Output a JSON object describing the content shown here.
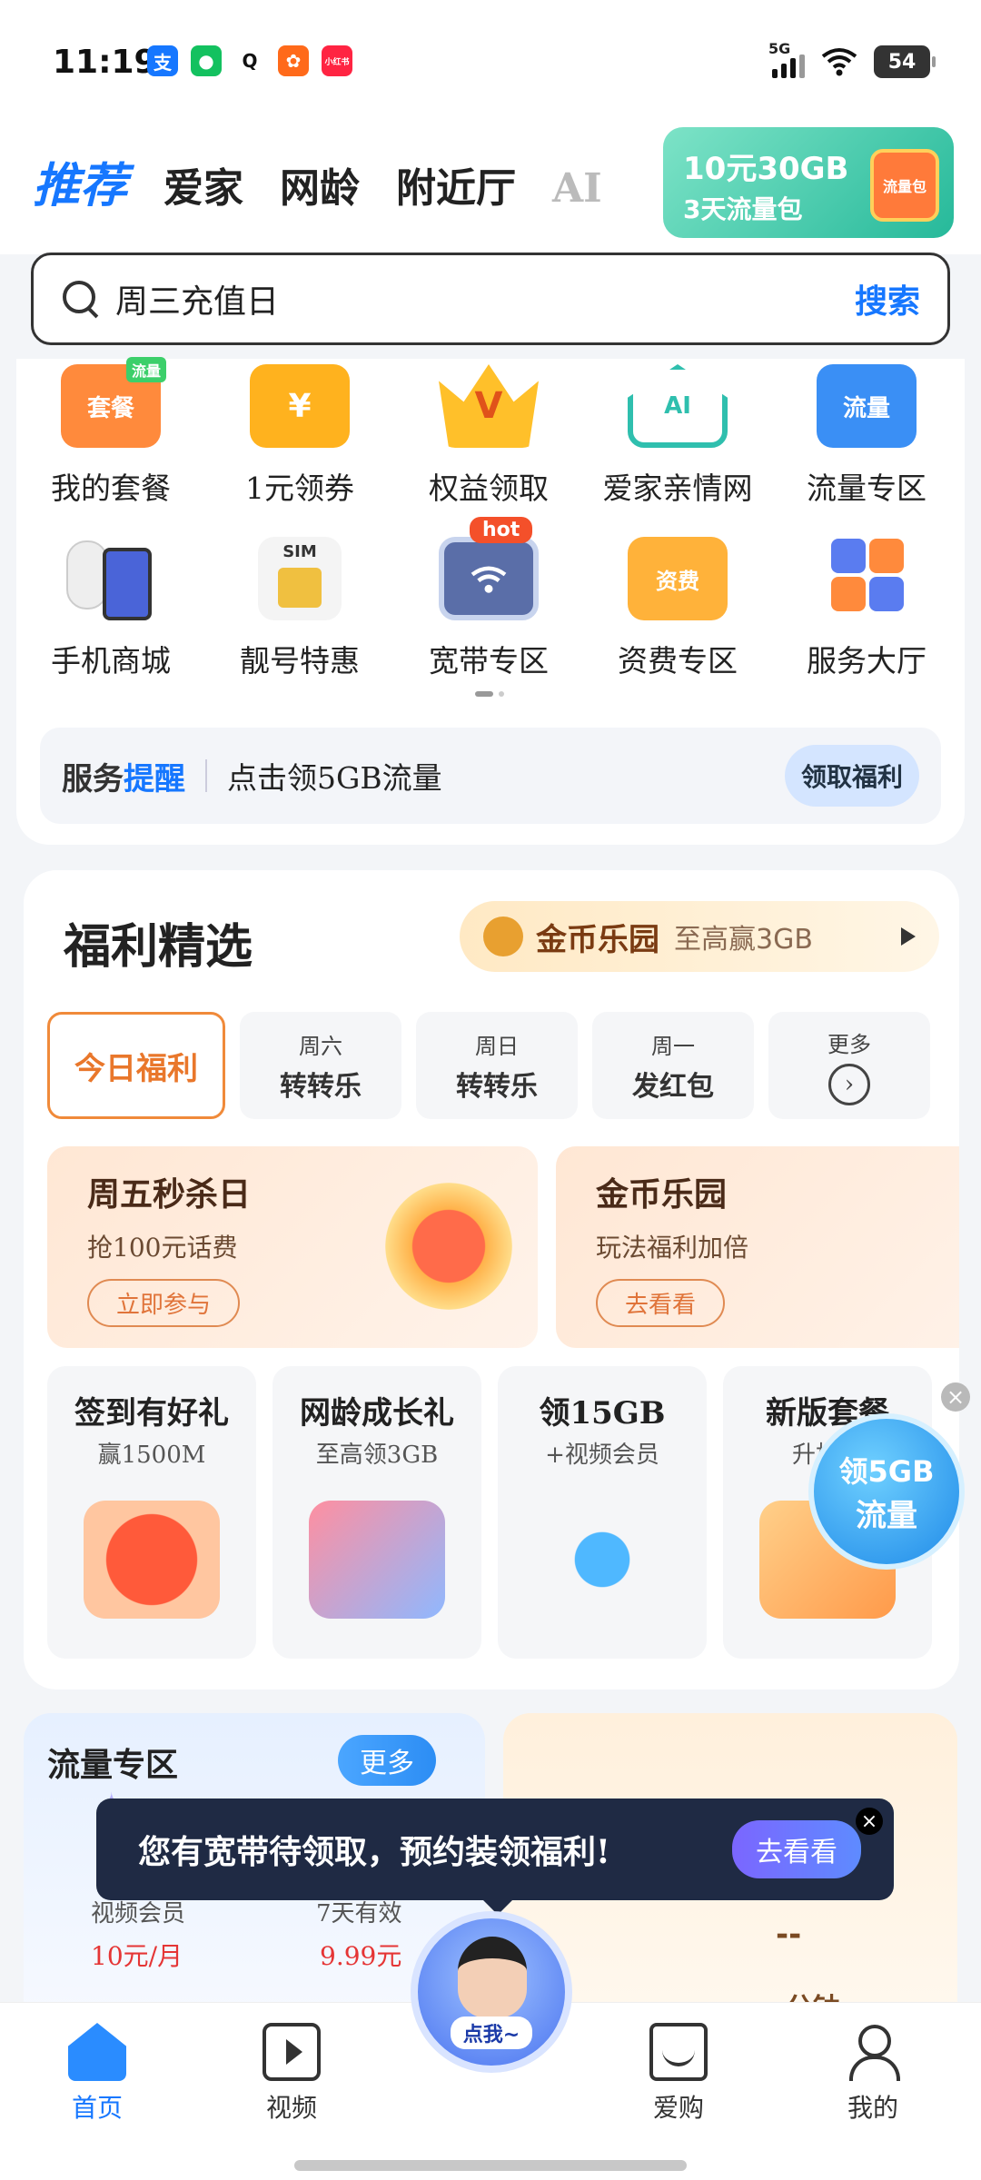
{
  "status_bar": {
    "time": "11:19",
    "network": "5G",
    "battery": "54",
    "app_icons": [
      {
        "name": "alipay-icon",
        "glyph": "支",
        "color": "#1677ff"
      },
      {
        "name": "wechat-icon",
        "glyph": "●",
        "color": "#13c15f"
      },
      {
        "name": "qq-icon",
        "glyph": "Q",
        "color": "#111111"
      },
      {
        "name": "taobao-icon",
        "glyph": "✿",
        "color": "#ff6a1a"
      },
      {
        "name": "xiaohongshu-icon",
        "glyph": "小红书",
        "color": "#ff2442"
      }
    ]
  },
  "top_nav": {
    "tabs": [
      "推荐",
      "爱家",
      "网龄",
      "附近厅",
      "AI"
    ],
    "promo_line1": "10元30GB",
    "promo_line2": "3天流量包",
    "promo_tag": "流量包"
  },
  "search": {
    "placeholder": "周三充值日",
    "button": "搜索"
  },
  "services": {
    "row1": [
      {
        "label": "我的套餐",
        "icon": "package-icon",
        "glyph": "套餐",
        "badge_text": "流量",
        "color": "#ff8a3c"
      },
      {
        "label": "1元领券",
        "icon": "coupon-icon",
        "glyph": "¥",
        "color": "#ffb21e"
      },
      {
        "label": "权益领取",
        "icon": "crown-icon",
        "glyph": "V",
        "color": "#ffc02a"
      },
      {
        "label": "爱家亲情网",
        "icon": "ai-home-icon",
        "glyph": "AI",
        "color": "#2fbfae"
      },
      {
        "label": "流量专区",
        "icon": "data-shop-icon",
        "glyph": "流量",
        "color": "#3a8ff5"
      }
    ],
    "row2": [
      {
        "label": "手机商城",
        "icon": "phone-camera-icon",
        "glyph": "",
        "color": "#4a64d8"
      },
      {
        "label": "靓号特惠",
        "icon": "sim-card-icon",
        "glyph": "SIM",
        "color": "#f0c040"
      },
      {
        "label": "宽带专区",
        "icon": "wifi-tv-icon",
        "glyph": "wifi",
        "color": "#5a6ea8",
        "hot": "hot"
      },
      {
        "label": "资费专区",
        "icon": "tariff-icon",
        "glyph": "资费",
        "color": "#ffb23a"
      },
      {
        "label": "服务大厅",
        "icon": "service-grid-icon",
        "glyph": "",
        "color": "#5a7cf0"
      }
    ]
  },
  "reminder": {
    "title_a": "服务",
    "title_b": "提醒",
    "text": "点击领5GB流量",
    "button": "领取福利"
  },
  "welfare": {
    "title": "福利精选",
    "coin_name": "金币乐园",
    "coin_sub": "至高赢3GB",
    "day_tabs": [
      {
        "day": "",
        "label": "今日福利",
        "active": true
      },
      {
        "day": "周六",
        "label": "转转乐"
      },
      {
        "day": "周日",
        "label": "转转乐"
      },
      {
        "day": "周一",
        "label": "发红包"
      },
      {
        "day": "更多",
        "label": ""
      }
    ],
    "promo_cards": [
      {
        "title": "周五秒杀日",
        "sub": "抢100元话费",
        "button": "立即参与"
      },
      {
        "title": "金币乐园",
        "sub": "玩法福利加倍",
        "button": "去看看"
      }
    ],
    "gift_cards": [
      {
        "title": "签到有好礼",
        "sub": "赢1500M",
        "color": "#ff6a4a"
      },
      {
        "title": "网龄成长礼",
        "sub": "至高领3GB",
        "color": "#ff8fa0"
      },
      {
        "title": "领15GB",
        "sub": "+视频会员",
        "color": "#4fb8ff"
      },
      {
        "title": "新版套餐",
        "sub": "升档享",
        "color": "#ffb24a"
      }
    ],
    "float_badge_1": "领5GB",
    "float_badge_2": "流量"
  },
  "flow": {
    "title": "流量专区",
    "more": "更多",
    "item1_sub": "视频会员",
    "item1_price": "10元/月",
    "item2_sub": "7天有效",
    "item2_price": "9.99元",
    "dash": "--",
    "minutes": "--分钟"
  },
  "tip": {
    "text": "您有宽带待领取，预约装领福利!",
    "button": "去看看"
  },
  "assistant": {
    "label": "点我~"
  },
  "bottom_nav": [
    {
      "label": "首页",
      "active": true
    },
    {
      "label": "视频"
    },
    {
      "label": "爱购"
    },
    {
      "label": "我的"
    }
  ]
}
